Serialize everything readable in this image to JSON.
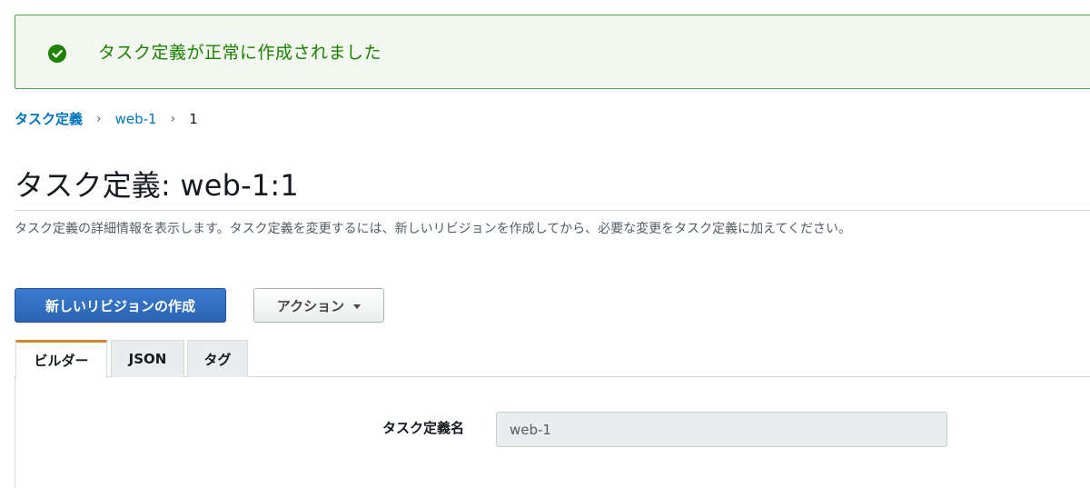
{
  "flash": {
    "message": "タスク定義が正常に作成されました",
    "icon": "check-circle-icon",
    "color": "#1d8102"
  },
  "breadcrumb": {
    "items": [
      "タスク定義",
      "web-1",
      "1"
    ],
    "separator": "›"
  },
  "header": {
    "title": "タスク定義: web-1:1",
    "description": "タスク定義の詳細情報を表示します。タスク定義を変更するには、新しいリビジョンを作成してから、必要な変更をタスク定義に加えてください。"
  },
  "actions": {
    "create_revision_label": "新しいリビジョンの作成",
    "actions_label": "アクション"
  },
  "tabs": [
    {
      "label": "ビルダー",
      "active": true
    },
    {
      "label": "JSON",
      "active": false
    },
    {
      "label": "タグ",
      "active": false
    }
  ],
  "form": {
    "task_definition_name_label": "タスク定義名",
    "task_definition_name_value": "web-1"
  },
  "colors": {
    "accent": "#d5852f",
    "primary_button": "#2c63b3",
    "link": "#0073bb",
    "success": "#1d8102"
  }
}
